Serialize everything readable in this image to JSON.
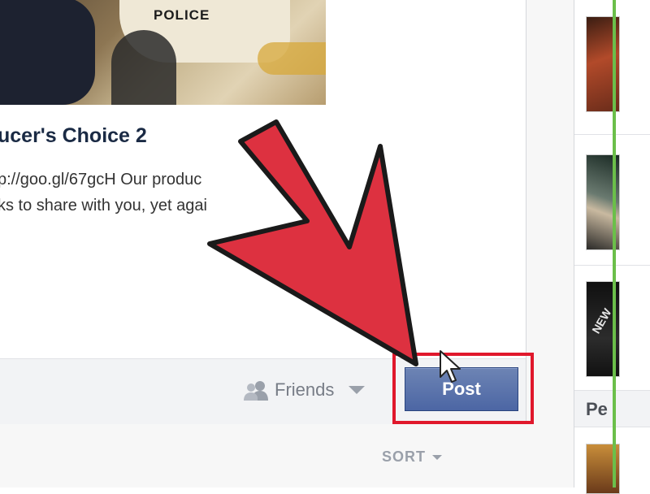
{
  "post": {
    "image_caption": "POLICE",
    "title": "ucer's Choice 2",
    "description_lines": [
      "p://goo.gl/67gcH Our produc",
      "ks to share with you, yet agai"
    ]
  },
  "composer": {
    "audience_label": "Friends",
    "audience_icon": "friends-icon",
    "post_button_label": "Post",
    "sort_label": "SORT"
  },
  "sidebar": {
    "section_label": "Pe",
    "thumb3_text": "NEW"
  },
  "colors": {
    "accent_button": "#4c66a4",
    "highlight": "#e0182c",
    "arrow_fill": "#dd3140"
  }
}
